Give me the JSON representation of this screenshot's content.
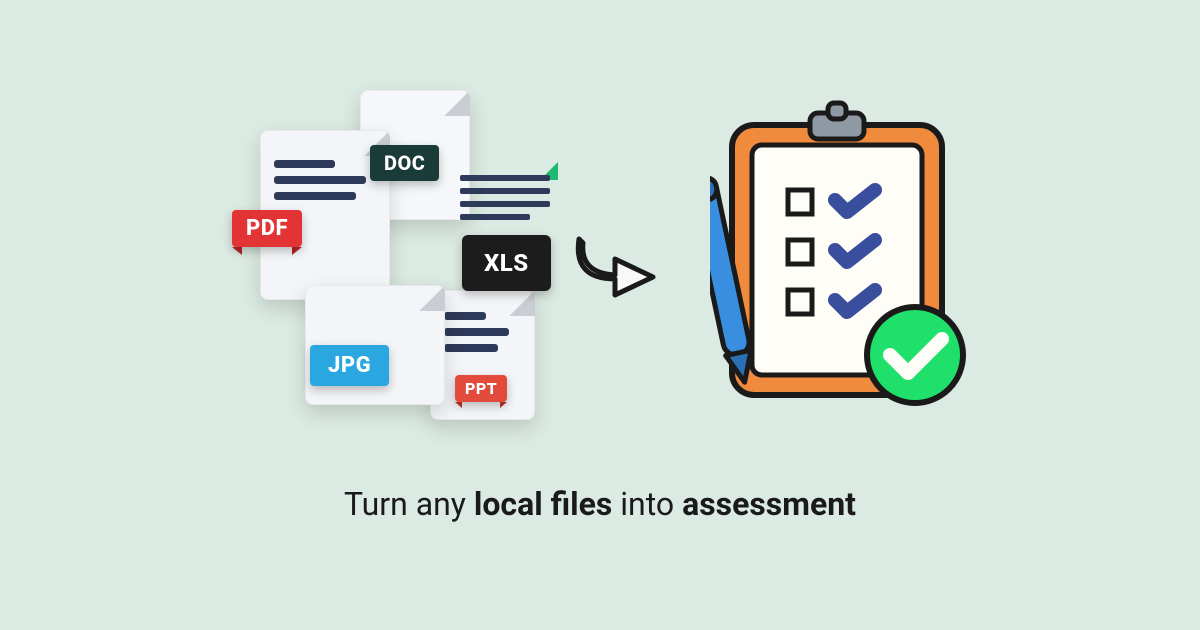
{
  "file_badges": {
    "pdf": "PDF",
    "doc": "DOC",
    "xls": "XLS",
    "jpg": "JPG",
    "ppt": "PPT"
  },
  "caption": {
    "part1": "Turn any ",
    "bold1": "local files",
    "part2": " into ",
    "bold2": "assessment"
  }
}
